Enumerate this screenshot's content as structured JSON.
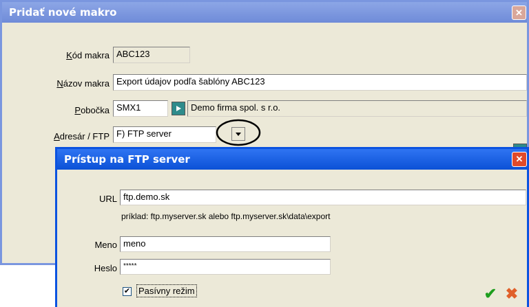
{
  "main_dialog": {
    "title": "Pridať nové makro",
    "close_glyph": "✕",
    "fields": {
      "kod_label_u": "K",
      "kod_label_rest": "ód makra",
      "kod_value": "ABC123",
      "nazov_label_u": "N",
      "nazov_label_rest": "ázov makra",
      "nazov_value": "Export údajov podľa šablóny ABC123",
      "pobocka_label_u": "P",
      "pobocka_label_rest": "obočka",
      "pobocka_value": "SMX1",
      "pobocka_name": "Demo firma spol. s r.o.",
      "adresar_label_u": "A",
      "adresar_label_rest": "dresár / FTP",
      "adresar_value": "F) FTP server"
    }
  },
  "ftp_dialog": {
    "title": "Prístup na FTP server",
    "close_glyph": "✕",
    "url_label": "URL",
    "url_value": "ftp.demo.sk",
    "url_hint": "príklad: ftp.myserver.sk alebo ftp.myserver.sk\\data\\export",
    "meno_label": "Meno",
    "meno_value": "meno",
    "heslo_label": "Heslo",
    "heslo_value": "*****",
    "passive_label": "Pasívny režim",
    "passive_checked": "✔",
    "ok_glyph": "✔",
    "cancel_glyph": "✖"
  },
  "colors": {
    "title_bg": "#7a96df",
    "active_title": "#1f5fd6",
    "close_red": "#e04a2a",
    "teal_button": "#2e8b8b"
  }
}
